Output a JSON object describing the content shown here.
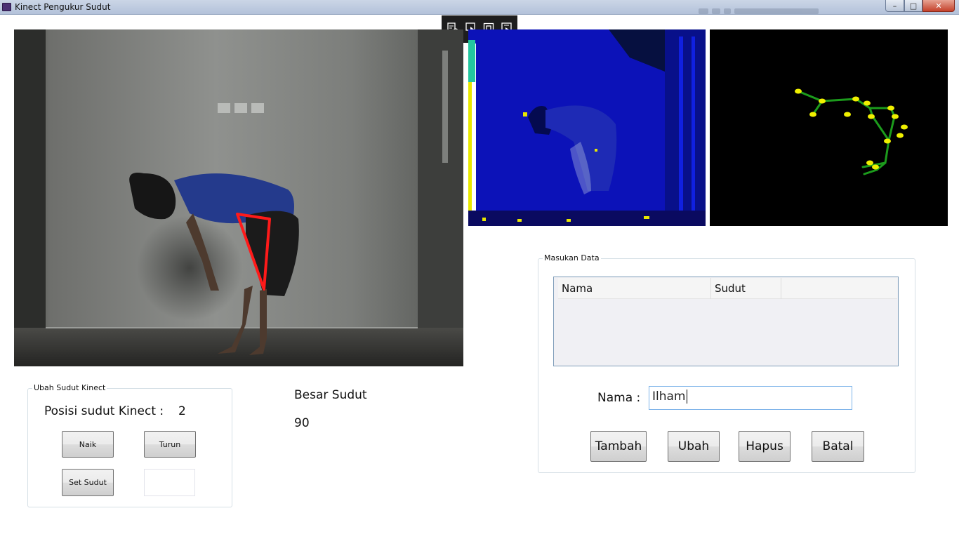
{
  "window": {
    "title": "Kinect Pengukur Sudut",
    "controls": {
      "minimize": "–",
      "maximize": "□",
      "close": "✕"
    }
  },
  "toolbar": {
    "icons": [
      "select-element-icon",
      "pointer-select-icon",
      "layout-adorner-icon",
      "track-focus-icon"
    ]
  },
  "colors": {
    "angle_line": "#ff1a1a",
    "bone": "#1c9b1c",
    "joint": "#f0f000",
    "depth_base": "#0a14c8"
  },
  "ubah_sudut": {
    "legend": "Ubah Sudut Kinect",
    "posisi_label": "Posisi sudut Kinect :",
    "posisi_value": "2",
    "naik_label": "Naik",
    "turun_label": "Turun",
    "set_label": "Set Sudut",
    "set_value": ""
  },
  "besar_sudut": {
    "label": "Besar Sudut",
    "value": "90"
  },
  "masukan": {
    "legend": "Masukan Data",
    "columns": [
      "Nama",
      "Sudut"
    ],
    "rows": [],
    "nama_label": "Nama :",
    "nama_value": "Ilham",
    "buttons": {
      "tambah": "Tambah",
      "ubah": "Ubah",
      "hapus": "Hapus",
      "batal": "Batal"
    }
  }
}
